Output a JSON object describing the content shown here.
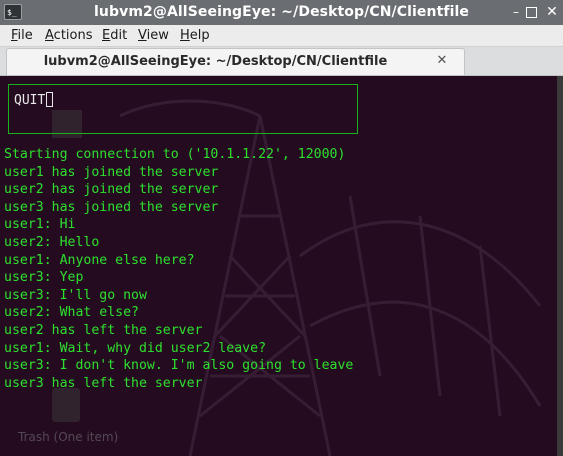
{
  "window": {
    "app_icon_text": "$_",
    "title": "lubvm2@AllSeeingEye: ~/Desktop/CN/Clientfile",
    "controls": {
      "minimize": "–",
      "maximize": "",
      "close": "✕"
    }
  },
  "menubar": {
    "items": [
      {
        "first": "F",
        "rest": "ile"
      },
      {
        "first": "A",
        "rest": "ctions"
      },
      {
        "first": "E",
        "rest": "dit"
      },
      {
        "first": "V",
        "rest": "iew"
      },
      {
        "first": "H",
        "rest": "elp"
      }
    ]
  },
  "tab": {
    "label": "lubvm2@AllSeeingEye: ~/Desktop/CN/Clientfile",
    "close": "✕"
  },
  "terminal": {
    "input_value": "QUIT",
    "output_lines": [
      "Starting connection to ('10.1.1.22', 12000)",
      "user1 has joined the server",
      "user2 has joined the server",
      "user3 has joined the server",
      "user1: Hi",
      "user2: Hello",
      "user1: Anyone else here?",
      "user3: Yep",
      "user3: I'll go now",
      "user2: What else?",
      "user2 has left the server",
      "user1: Wait, why did user2 leave?",
      "user3: I don't know. I'm also going to leave",
      "user3 has left the server"
    ]
  },
  "desktop": {
    "trash_label": "Trash (One item)"
  },
  "colors": {
    "terminal_bg": "#240b20",
    "text_green": "#2ee02e",
    "box_border": "#19b219",
    "titlebar_bg": "#6a6e73"
  }
}
